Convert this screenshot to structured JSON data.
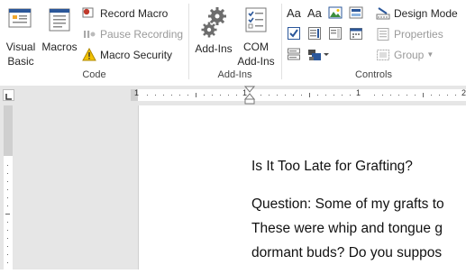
{
  "ribbon": {
    "code": {
      "label": "Code",
      "visual_basic": [
        "Visual",
        "Basic"
      ],
      "macros": "Macros",
      "record_macro": "Record Macro",
      "pause_recording": "Pause Recording",
      "macro_security": "Macro Security"
    },
    "addins": {
      "label": "Add-Ins",
      "add_ins": "Add-Ins",
      "com_add_ins": [
        "COM",
        "Add-Ins"
      ]
    },
    "controls": {
      "label": "Controls",
      "design_mode": "Design Mode",
      "properties": "Properties",
      "group": "Group",
      "rich_text_glyph": "Aa",
      "plain_text_glyph": "Aa"
    }
  },
  "ruler": {
    "numbers": [
      "1",
      "1",
      "1",
      "2"
    ]
  },
  "document": {
    "lines": [
      "Is It Too Late for Grafting?",
      "Question: Some of my grafts to",
      "These were whip and tongue g",
      "dormant buds?  Do you suppos"
    ]
  },
  "colors": {
    "accent_blue": "#2b579a",
    "gear_gray": "#6d6d6d",
    "warning_yellow": "#f2c200",
    "record_red": "#c0392b"
  }
}
